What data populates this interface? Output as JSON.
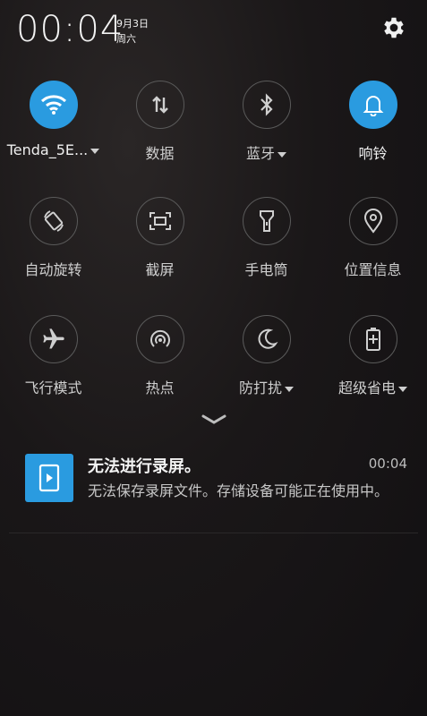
{
  "status": {
    "time": "00:04",
    "date": "9月3日",
    "weekday": "周六"
  },
  "quick_settings": [
    {
      "label": "Tenda_5E...",
      "icon": "wifi-icon",
      "active": true,
      "dropdown": true
    },
    {
      "label": "数据",
      "icon": "data-transfer-icon",
      "active": false,
      "dropdown": false
    },
    {
      "label": "蓝牙",
      "icon": "bluetooth-icon",
      "active": false,
      "dropdown": true
    },
    {
      "label": "响铃",
      "icon": "bell-icon",
      "active": true,
      "dropdown": false
    },
    {
      "label": "自动旋转",
      "icon": "auto-rotate-icon",
      "active": false,
      "dropdown": false
    },
    {
      "label": "截屏",
      "icon": "screenshot-icon",
      "active": false,
      "dropdown": false
    },
    {
      "label": "手电筒",
      "icon": "flashlight-icon",
      "active": false,
      "dropdown": false
    },
    {
      "label": "位置信息",
      "icon": "location-pin-icon",
      "active": false,
      "dropdown": false
    },
    {
      "label": "飞行模式",
      "icon": "airplane-icon",
      "active": false,
      "dropdown": false
    },
    {
      "label": "热点",
      "icon": "hotspot-icon",
      "active": false,
      "dropdown": false
    },
    {
      "label": "防打扰",
      "icon": "moon-icon",
      "active": false,
      "dropdown": true
    },
    {
      "label": "超级省电",
      "icon": "battery-saver-icon",
      "active": false,
      "dropdown": true
    }
  ],
  "notification": {
    "title": "无法进行录屏。",
    "time": "00:04",
    "body": "无法保存录屏文件。存储设备可能正在使用中。",
    "icon": "screen-record-icon",
    "accent_color": "#2a9be0"
  }
}
